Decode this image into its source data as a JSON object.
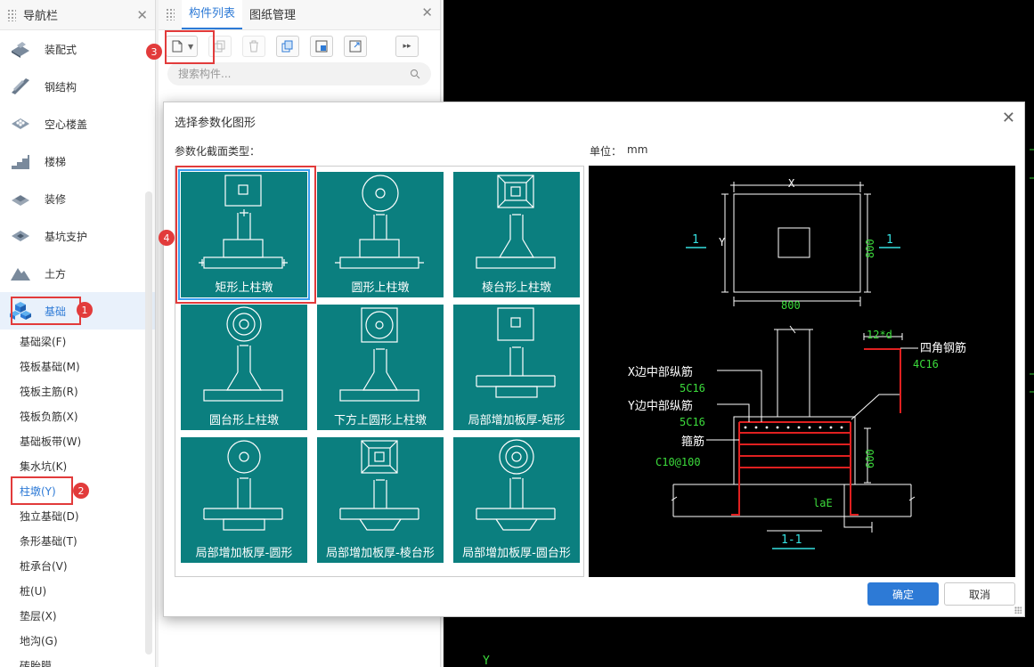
{
  "nav": {
    "title": "导航栏",
    "categories": [
      {
        "label": "装配式",
        "icon": "prefab-icon"
      },
      {
        "label": "钢结构",
        "icon": "steel-icon"
      },
      {
        "label": "空心楼盖",
        "icon": "hollow-slab-icon"
      },
      {
        "label": "楼梯",
        "icon": "stairs-icon"
      },
      {
        "label": "装修",
        "icon": "decoration-icon"
      },
      {
        "label": "基坑支护",
        "icon": "pit-support-icon"
      },
      {
        "label": "土方",
        "icon": "earthwork-icon"
      },
      {
        "label": "基础",
        "icon": "foundation-icon"
      }
    ],
    "sub_items": [
      "基础梁(F)",
      "筏板基础(M)",
      "筏板主筋(R)",
      "筏板负筋(X)",
      "基础板带(W)",
      "集水坑(K)",
      "柱墩(Y)",
      "独立基础(D)",
      "条形基础(T)",
      "桩承台(V)",
      "桩(U)",
      "垫层(X)",
      "地沟(G)",
      "砖胎膜"
    ]
  },
  "panel": {
    "tabs": [
      "构件列表",
      "图纸管理"
    ],
    "search_placeholder": "搜索构件..."
  },
  "markers": [
    "1",
    "2",
    "3",
    "4"
  ],
  "dialog": {
    "title": "选择参数化图形",
    "section_label": "参数化截面类型：",
    "unit_label": "单位：",
    "unit_value": "mm",
    "shapes": [
      "矩形上柱墩",
      "圆形上柱墩",
      "棱台形上柱墩",
      "圆台形上柱墩",
      "下方上圆形上柱墩",
      "局部增加板厚-矩形",
      "局部增加板厚-圆形",
      "局部增加板厚-棱台形",
      "局部增加板厚-圆台形"
    ],
    "ok_label": "确定",
    "cancel_label": "取消"
  },
  "preview": {
    "dim_x": "X",
    "dim_y": "Y",
    "dim_800_bottom": "800",
    "dim_800_right": "800",
    "section_mark": "1",
    "corner_rebar_label": "四角钢筋",
    "corner_rebar_value": "4C16",
    "anchor_label": "12*d",
    "x_rebar_label": "X边中部纵筋",
    "x_rebar_value": "5C16",
    "y_rebar_label": "Y边中部纵筋",
    "y_rebar_value": "5C16",
    "stirrup_label": "箍筋",
    "stirrup_value": "C10@100",
    "dim_600": "600",
    "lae_label": "laE",
    "section_title": "1-1"
  },
  "canvas": {
    "axis_label": "Y"
  },
  "colors": {
    "accent": "#2d7ad6",
    "tile": "#0b7f7f",
    "marker": "#e23b3b",
    "cad_green": "#3cdc3c",
    "cad_cyan": "#35e0e0",
    "cad_red": "#e02020"
  }
}
